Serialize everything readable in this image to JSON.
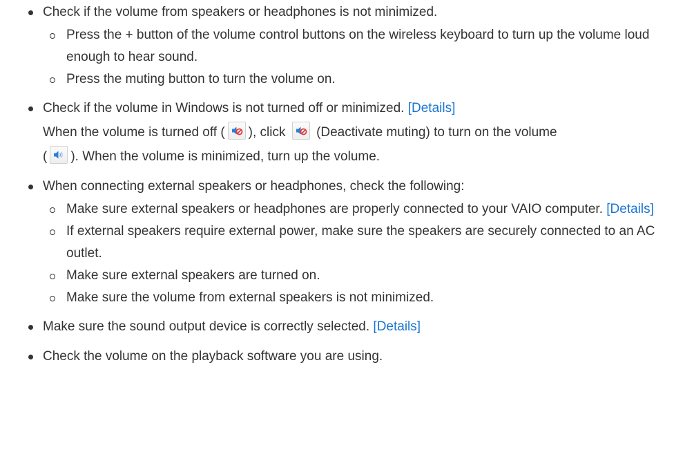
{
  "items": [
    {
      "text": "Check if the volume from speakers or headphones is not minimized.",
      "sub": [
        "Press the + button of the volume control buttons on the wireless keyboard to turn up the volume loud enough to hear sound.",
        "Press the muting button to turn the volume on."
      ]
    },
    {
      "text": "Check if the volume in Windows is not turned off or minimized.",
      "link": "[Details]",
      "para": {
        "part1": "When the volume is turned off (",
        "part2": "), click",
        "part3": "(Deactivate muting) to turn on the volume",
        "part4": "(",
        "part5": "). When the volume is minimized, turn up the volume."
      }
    },
    {
      "text": "When connecting external speakers or headphones, check the following:",
      "sub": [
        "Make sure external speakers or headphones are properly connected to your VAIO computer.",
        "If external speakers require external power, make sure the speakers are securely connected to an AC outlet.",
        "Make sure external speakers are turned on.",
        "Make sure the volume from external speakers is not minimized."
      ],
      "sub_link": "[Details]"
    },
    {
      "text": "Make sure the sound output device is correctly selected.",
      "link": "[Details]"
    },
    {
      "text": "Check the volume on the playback software you are using."
    }
  ],
  "icons": {
    "muted": "speaker-muted-icon",
    "unmuted": "speaker-on-icon"
  },
  "colors": {
    "text": "#333333",
    "link": "#1a75d2",
    "speaker_blue": "#2f7fd6",
    "mute_red": "#e23b3b"
  }
}
